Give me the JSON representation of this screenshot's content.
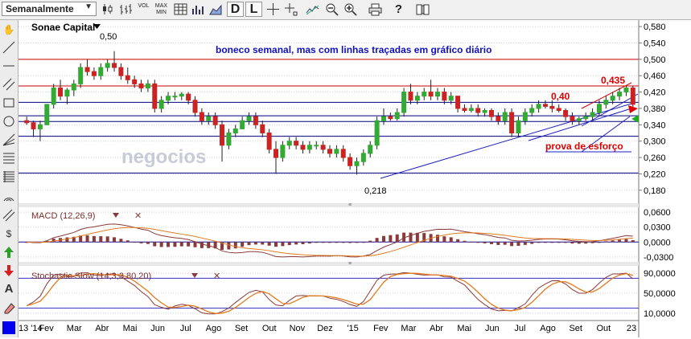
{
  "toolbar": {
    "period_label": "Semanalmente",
    "vol_label": "VOL",
    "maxmin_label": "MAX MIN",
    "d_label": "D",
    "l_label": "L",
    "icons": [
      "candlestick-icon",
      "ohlc-icon",
      "line-chart-icon",
      "table-icon",
      "bars-icon",
      "area-icon",
      "daily-button",
      "log-button",
      "crosshair-icon",
      "crosshair-label-icon",
      "trend-icon",
      "zoom-out-icon",
      "zoom-in-icon",
      "print-icon",
      "help-icon",
      "book-icon"
    ]
  },
  "sidebar": {
    "icons": [
      "hand-icon",
      "trendline-icon",
      "hline-icon",
      "channel-icon",
      "rectangle-icon",
      "circle-icon",
      "fib-fan-icon",
      "fib-retracement-icon",
      "fib-extension-icon",
      "grid-icon",
      "arc-icon",
      "parallel-lines-icon",
      "speed-lines-icon",
      "dollar-icon",
      "up-arrow-icon",
      "down-arrow-icon",
      "text-icon",
      "eraser-icon",
      "color-swatch-icon"
    ]
  },
  "chart_data": {
    "type": "candlestick",
    "title": "Sonae Capital",
    "annotation": "boneco semanal, mas com linhas traçadas em gráfico diário",
    "price_labels": {
      "high": "0,50",
      "low": "0,218",
      "mid": "0,40",
      "recent": "0,435"
    },
    "callout": "prova de esforço",
    "watermark": "negocios",
    "ylim": [
      0.16,
      0.59
    ],
    "y_ticks": [
      "0,580",
      "0,540",
      "0,500",
      "0,460",
      "0,420",
      "0,380",
      "0,340",
      "0,300",
      "0,260",
      "0,220",
      "0,180"
    ],
    "x_ticks": [
      "13 '14",
      "Fev",
      "Mar",
      "Abr",
      "Mai",
      "Jun",
      "Jul",
      "Ago",
      "Set",
      "Out",
      "Nov",
      "Dez",
      "'15",
      "Fev",
      "Mar",
      "Abr",
      "Mai",
      "Jun",
      "Jul",
      "Ago",
      "Set",
      "Out",
      "23"
    ],
    "horizontal_levels": [
      {
        "y": 0.5,
        "color": "#cc0000"
      },
      {
        "y": 0.435,
        "color": "#cc0000"
      },
      {
        "y": 0.395,
        "color": "#000080"
      },
      {
        "y": 0.362,
        "color": "#000080"
      },
      {
        "y": 0.348,
        "color": "#000080"
      },
      {
        "y": 0.312,
        "color": "#000080"
      },
      {
        "y": 0.222,
        "color": "#000080"
      }
    ],
    "candles": [
      [
        0.35,
        0.36,
        0.34,
        0.345
      ],
      [
        0.345,
        0.35,
        0.31,
        0.33
      ],
      [
        0.33,
        0.35,
        0.3,
        0.34
      ],
      [
        0.34,
        0.39,
        0.34,
        0.39
      ],
      [
        0.39,
        0.44,
        0.38,
        0.43
      ],
      [
        0.43,
        0.45,
        0.4,
        0.41
      ],
      [
        0.41,
        0.43,
        0.39,
        0.425
      ],
      [
        0.425,
        0.45,
        0.41,
        0.44
      ],
      [
        0.44,
        0.49,
        0.43,
        0.48
      ],
      [
        0.48,
        0.5,
        0.46,
        0.47
      ],
      [
        0.47,
        0.48,
        0.45,
        0.46
      ],
      [
        0.46,
        0.49,
        0.45,
        0.48
      ],
      [
        0.48,
        0.5,
        0.47,
        0.49
      ],
      [
        0.49,
        0.52,
        0.47,
        0.48
      ],
      [
        0.48,
        0.49,
        0.45,
        0.46
      ],
      [
        0.46,
        0.48,
        0.44,
        0.45
      ],
      [
        0.45,
        0.46,
        0.43,
        0.44
      ],
      [
        0.44,
        0.45,
        0.42,
        0.43
      ],
      [
        0.43,
        0.45,
        0.42,
        0.44
      ],
      [
        0.44,
        0.45,
        0.37,
        0.38
      ],
      [
        0.38,
        0.41,
        0.37,
        0.4
      ],
      [
        0.4,
        0.42,
        0.39,
        0.41
      ],
      [
        0.41,
        0.42,
        0.4,
        0.41
      ],
      [
        0.41,
        0.42,
        0.4,
        0.415
      ],
      [
        0.415,
        0.42,
        0.39,
        0.4
      ],
      [
        0.4,
        0.41,
        0.36,
        0.37
      ],
      [
        0.37,
        0.38,
        0.34,
        0.35
      ],
      [
        0.35,
        0.37,
        0.34,
        0.36
      ],
      [
        0.36,
        0.37,
        0.33,
        0.34
      ],
      [
        0.34,
        0.35,
        0.25,
        0.29
      ],
      [
        0.29,
        0.33,
        0.28,
        0.32
      ],
      [
        0.32,
        0.34,
        0.31,
        0.33
      ],
      [
        0.33,
        0.36,
        0.33,
        0.35
      ],
      [
        0.35,
        0.37,
        0.34,
        0.36
      ],
      [
        0.36,
        0.37,
        0.33,
        0.34
      ],
      [
        0.34,
        0.35,
        0.31,
        0.32
      ],
      [
        0.32,
        0.33,
        0.27,
        0.28
      ],
      [
        0.28,
        0.3,
        0.22,
        0.26
      ],
      [
        0.26,
        0.3,
        0.25,
        0.29
      ],
      [
        0.29,
        0.31,
        0.28,
        0.3
      ],
      [
        0.3,
        0.31,
        0.28,
        0.29
      ],
      [
        0.29,
        0.3,
        0.27,
        0.28
      ],
      [
        0.28,
        0.3,
        0.27,
        0.29
      ],
      [
        0.29,
        0.3,
        0.28,
        0.29
      ],
      [
        0.29,
        0.3,
        0.27,
        0.28
      ],
      [
        0.28,
        0.29,
        0.26,
        0.27
      ],
      [
        0.27,
        0.29,
        0.26,
        0.28
      ],
      [
        0.28,
        0.29,
        0.25,
        0.26
      ],
      [
        0.26,
        0.27,
        0.23,
        0.24
      ],
      [
        0.24,
        0.26,
        0.218,
        0.25
      ],
      [
        0.25,
        0.28,
        0.24,
        0.27
      ],
      [
        0.27,
        0.3,
        0.26,
        0.29
      ],
      [
        0.29,
        0.36,
        0.28,
        0.35
      ],
      [
        0.35,
        0.38,
        0.34,
        0.36
      ],
      [
        0.36,
        0.37,
        0.35,
        0.355
      ],
      [
        0.355,
        0.38,
        0.35,
        0.37
      ],
      [
        0.37,
        0.43,
        0.36,
        0.42
      ],
      [
        0.42,
        0.44,
        0.39,
        0.4
      ],
      [
        0.4,
        0.42,
        0.39,
        0.41
      ],
      [
        0.41,
        0.43,
        0.4,
        0.42
      ],
      [
        0.42,
        0.45,
        0.4,
        0.41
      ],
      [
        0.41,
        0.43,
        0.4,
        0.42
      ],
      [
        0.42,
        0.43,
        0.39,
        0.4
      ],
      [
        0.4,
        0.42,
        0.39,
        0.41
      ],
      [
        0.41,
        0.41,
        0.37,
        0.38
      ],
      [
        0.38,
        0.39,
        0.37,
        0.375
      ],
      [
        0.375,
        0.39,
        0.37,
        0.38
      ],
      [
        0.38,
        0.39,
        0.36,
        0.37
      ],
      [
        0.37,
        0.38,
        0.36,
        0.375
      ],
      [
        0.375,
        0.38,
        0.35,
        0.36
      ],
      [
        0.36,
        0.37,
        0.34,
        0.35
      ],
      [
        0.35,
        0.38,
        0.34,
        0.37
      ],
      [
        0.37,
        0.38,
        0.31,
        0.32
      ],
      [
        0.32,
        0.36,
        0.31,
        0.35
      ],
      [
        0.35,
        0.38,
        0.34,
        0.37
      ],
      [
        0.37,
        0.39,
        0.36,
        0.38
      ],
      [
        0.38,
        0.4,
        0.37,
        0.39
      ],
      [
        0.39,
        0.4,
        0.38,
        0.385
      ],
      [
        0.385,
        0.4,
        0.37,
        0.38
      ],
      [
        0.38,
        0.39,
        0.37,
        0.375
      ],
      [
        0.375,
        0.38,
        0.35,
        0.36
      ],
      [
        0.36,
        0.37,
        0.34,
        0.35
      ],
      [
        0.35,
        0.36,
        0.34,
        0.355
      ],
      [
        0.355,
        0.37,
        0.35,
        0.36
      ],
      [
        0.36,
        0.38,
        0.35,
        0.37
      ],
      [
        0.37,
        0.4,
        0.36,
        0.39
      ],
      [
        0.39,
        0.41,
        0.38,
        0.4
      ],
      [
        0.4,
        0.42,
        0.39,
        0.41
      ],
      [
        0.41,
        0.43,
        0.4,
        0.42
      ],
      [
        0.42,
        0.435,
        0.41,
        0.43
      ],
      [
        0.43,
        0.435,
        0.38,
        0.39
      ]
    ],
    "macd": {
      "title": "MACD (12,26,9)",
      "ylim": [
        -0.035,
        0.065
      ],
      "y_ticks": [
        "0,0600",
        "0,0300",
        "0,0000",
        "-0,0300"
      ]
    },
    "stochastic": {
      "title": "Stochastic Slow (14,3,3,80,20)",
      "ylim": [
        0,
        100
      ],
      "y_ticks": [
        "90,0000",
        "50,0000",
        "10,0000"
      ]
    }
  }
}
